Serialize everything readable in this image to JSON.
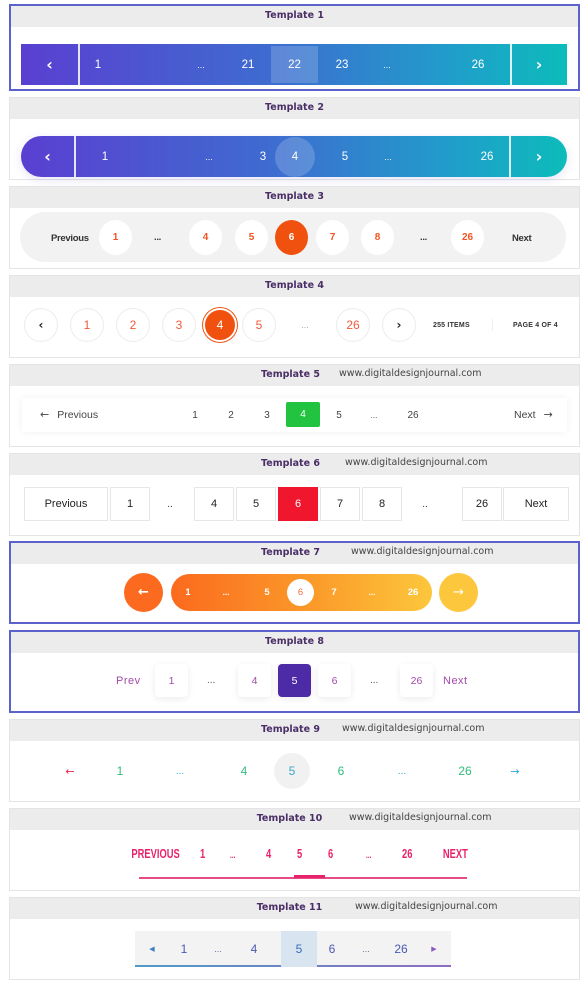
{
  "site": "www.digitaldesignjournal.com",
  "templates": {
    "t1": {
      "title": "Template 1",
      "prev_icon": "chevron-left",
      "next_icon": "chevron-right",
      "pages": [
        "1",
        "...",
        "21",
        "22",
        "23",
        "...",
        "26"
      ],
      "active": "22",
      "colors": {
        "start": "#5a3fd1",
        "end": "#0cbcba"
      }
    },
    "t2": {
      "title": "Template 2",
      "prev_icon": "chevron-left",
      "next_icon": "chevron-right",
      "pages": [
        "1",
        "...",
        "3",
        "4",
        "5",
        "...",
        "26"
      ],
      "active": "4",
      "colors": {
        "start": "#5a3fd1",
        "end": "#0cbcba"
      }
    },
    "t3": {
      "title": "Template 3",
      "prev_label": "Previous",
      "next_label": "Next",
      "pages": [
        "1",
        "...",
        "4",
        "5",
        "6",
        "7",
        "8",
        "...",
        "26"
      ],
      "active": "6",
      "colors": {
        "accent": "#f0510f"
      }
    },
    "t4": {
      "title": "Template 4",
      "prev_icon": "chevron-left",
      "next_icon": "chevron-right",
      "pages": [
        "1",
        "2",
        "3",
        "4",
        "5",
        "...",
        "26"
      ],
      "active": "4",
      "items_label": "255 ITEMS",
      "page_label": "PAGE 4 OF 4",
      "colors": {
        "accent": "#f0510f"
      }
    },
    "t5": {
      "title": "Template 5",
      "prev_label": "Previous",
      "next_label": "Next",
      "prev_icon": "arrow-left",
      "next_icon": "arrow-right",
      "pages": [
        "1",
        "2",
        "3",
        "4",
        "5",
        "...",
        "26"
      ],
      "active": "4",
      "colors": {
        "accent": "#22c33e"
      }
    },
    "t6": {
      "title": "Template 6",
      "prev_label": "Previous",
      "next_label": "Next",
      "pages": [
        "1",
        "..",
        "4",
        "5",
        "6",
        "7",
        "8",
        "..",
        "26"
      ],
      "active": "6",
      "colors": {
        "accent": "#f0162d"
      }
    },
    "t7": {
      "title": "Template 7",
      "prev_icon": "arrow-left",
      "next_icon": "arrow-right",
      "pages": [
        "1",
        "...",
        "5",
        "6",
        "7",
        "...",
        "26"
      ],
      "active": "6",
      "colors": {
        "start": "#fb6a1e",
        "end": "#fcc73c"
      }
    },
    "t8": {
      "title": "Template 8",
      "prev_label": "Prev",
      "next_label": "Next",
      "pages": [
        "1",
        "...",
        "4",
        "5",
        "6",
        "...",
        "26"
      ],
      "active": "5",
      "colors": {
        "accent": "#4d2aa6",
        "text": "#a14aa8"
      }
    },
    "t9": {
      "title": "Template 9",
      "prev_icon": "arrow-left",
      "next_icon": "arrow-right",
      "pages": [
        "1",
        "...",
        "4",
        "5",
        "6",
        "...",
        "26"
      ],
      "active": "5",
      "colors": {
        "text": "#2fbd7a",
        "prev": "#e8234a",
        "next": "#2aa8d8"
      }
    },
    "t10": {
      "title": "Template 10",
      "prev_label": "PREVIOUS",
      "next_label": "NEXT",
      "pages": [
        "1",
        "...",
        "4",
        "5",
        "6",
        "...",
        "26"
      ],
      "active": "5",
      "colors": {
        "accent": "#e8236b"
      }
    },
    "t11": {
      "title": "Template 11",
      "prev_icon": "triangle-left",
      "next_icon": "triangle-right",
      "pages": [
        "1",
        "...",
        "4",
        "5",
        "6",
        "...",
        "26"
      ],
      "active": "5",
      "colors": {
        "text": "#4a5ab0",
        "active_bg": "#d8e4ef"
      }
    }
  }
}
